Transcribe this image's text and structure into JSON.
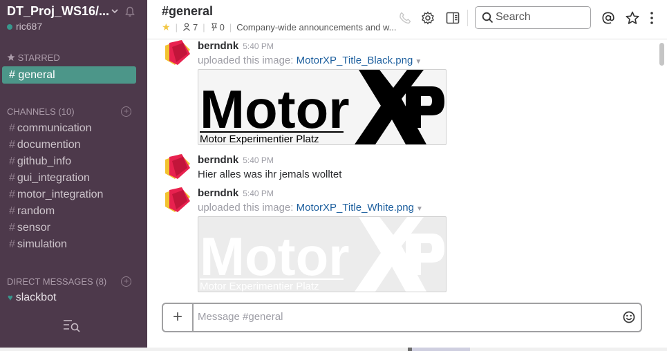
{
  "sidebar": {
    "team_name": "DT_Proj_WS16/...",
    "username": "ric687",
    "starred_title": "STARRED",
    "active_channel": "# general",
    "channels_title": "CHANNELS",
    "channels_count": "(10)",
    "channels": [
      "communication",
      "documention",
      "github_info",
      "gui_integration",
      "motor_integration",
      "random",
      "sensor",
      "simulation"
    ],
    "hash": "#",
    "dm_title": "DIRECT MESSAGES",
    "dm_count": "(8)",
    "dms": [
      "slackbot"
    ]
  },
  "header": {
    "channel_name": "#general",
    "members": "7",
    "pins": "0",
    "purpose": "Company-wide announcements and w...",
    "search_placeholder": "Search"
  },
  "messages": [
    {
      "author": "berndnk",
      "time": "5:40 PM",
      "prefix": "uploaded this image:",
      "file": "MotorXP_Title_Black.png"
    },
    {
      "author": "berndnk",
      "time": "5:40 PM",
      "text": "Hier alles was ihr jemals wolltet"
    },
    {
      "author": "berndnk",
      "time": "5:40 PM",
      "prefix": "uploaded this image:",
      "file": "MotorXP_Title_White.png"
    }
  ],
  "images": {
    "logo_word": "Motor",
    "logo_xp": "XP",
    "logo_sub": "Motor Experimentier Platz"
  },
  "composer": {
    "placeholder": "Message #general",
    "plus": "+"
  },
  "colors": {
    "sidebar_bg": "#4d394b",
    "active_channel": "#4c9689",
    "presence": "#38978d",
    "link": "#1d5f9e",
    "star": "#f2c744"
  }
}
